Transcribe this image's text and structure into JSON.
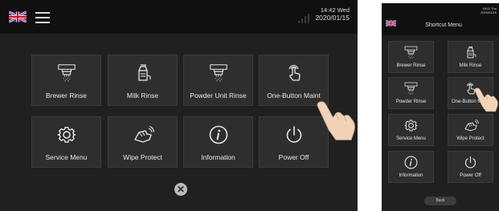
{
  "left_screen": {
    "status": {
      "time": "14:42 Wed",
      "date": "2020/01/15"
    },
    "tiles": [
      {
        "label": "Brewer Rinse",
        "icon": "brewer-rinse-icon"
      },
      {
        "label": "Milk Rinse",
        "icon": "milk-rinse-icon"
      },
      {
        "label": "Powder Unit Rinse",
        "icon": "powder-rinse-icon"
      },
      {
        "label": "One-Button Maint",
        "icon": "touch-hand-icon"
      },
      {
        "label": "Service Menu",
        "icon": "gear-icon"
      },
      {
        "label": "Wipe Protect",
        "icon": "wipe-hand-icon"
      },
      {
        "label": "Information",
        "icon": "info-icon"
      },
      {
        "label": "Power Off",
        "icon": "power-icon"
      }
    ],
    "close_symbol": "✕"
  },
  "right_screen": {
    "status": {
      "time": "18:11 Thu",
      "date": "2020/01/16"
    },
    "title": "Shortcut Menu",
    "tiles": [
      {
        "label": "Brewer Rinse",
        "icon": "brewer-rinse-icon"
      },
      {
        "label": "Milk Rinse",
        "icon": "milk-rinse-icon"
      },
      {
        "label": "Powder Rinse",
        "icon": "powder-rinse-icon"
      },
      {
        "label": "One-Button Maint",
        "icon": "touch-hand-icon"
      },
      {
        "label": "Service Menu",
        "icon": "gear-icon"
      },
      {
        "label": "Wipe Protect",
        "icon": "wipe-hand-icon"
      },
      {
        "label": "Information",
        "icon": "info-icon"
      },
      {
        "label": "Power Off",
        "icon": "power-icon"
      }
    ],
    "back_label": "Back"
  },
  "icon_badges": {
    "rinse": "Rinse",
    "powder": "Powder"
  }
}
